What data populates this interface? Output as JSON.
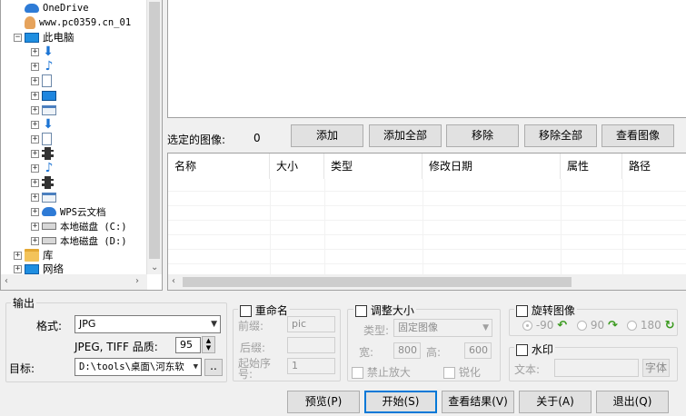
{
  "tree": {
    "items": [
      {
        "label": "OneDrive",
        "icon": "onedrive-cloud-icon"
      },
      {
        "label": "www.pc0359.cn_01",
        "icon": "user-folder-icon"
      },
      {
        "label": "此电脑",
        "icon": "computer-icon"
      },
      {
        "label": "",
        "icon": "downloads-icon"
      },
      {
        "label": "",
        "icon": "music-icon"
      },
      {
        "label": "",
        "icon": "documents-icon"
      },
      {
        "label": "",
        "icon": "desktop-icon"
      },
      {
        "label": "",
        "icon": "window-icon"
      },
      {
        "label": "",
        "icon": "downloads-icon"
      },
      {
        "label": "",
        "icon": "documents-icon"
      },
      {
        "label": "",
        "icon": "video-icon"
      },
      {
        "label": "",
        "icon": "music-icon"
      },
      {
        "label": "",
        "icon": "video-icon"
      },
      {
        "label": "",
        "icon": "window-icon"
      },
      {
        "label": "WPS云文档",
        "icon": "wps-cloud-icon"
      },
      {
        "label": "本地磁盘 (C:)",
        "icon": "drive-icon"
      },
      {
        "label": "本地磁盘 (D:)",
        "icon": "drive-icon"
      },
      {
        "label": "库",
        "icon": "library-folder-icon"
      },
      {
        "label": "网络",
        "icon": "network-icon"
      }
    ]
  },
  "selected": {
    "label": "选定的图像:",
    "count": "0"
  },
  "buttons": {
    "add": "添加",
    "add_all": "添加全部",
    "remove": "移除",
    "remove_all": "移除全部",
    "view_image": "查看图像",
    "preview": "预览(P)",
    "start": "开始(S)",
    "view_result": "查看结果(V)",
    "about": "关于(A)",
    "exit": "退出(Q)",
    "browse": "..",
    "font": "字体"
  },
  "filelist": {
    "columns": [
      "名称",
      "大小",
      "类型",
      "修改日期",
      "属性",
      "路径"
    ]
  },
  "output": {
    "title": "输出",
    "format_label": "格式:",
    "format_value": "JPG",
    "quality_label": "JPEG, TIFF 品质:",
    "quality_value": "95",
    "target_label": "目标:",
    "target_value": "D:\\tools\\桌面\\河东软"
  },
  "rename": {
    "title": "重命名",
    "prefix_label": "前缀:",
    "prefix_value": "pic",
    "suffix_label": "后缀:",
    "suffix_value": "",
    "start_label": "起始序号:",
    "start_value": "1"
  },
  "resize": {
    "title": "调整大小",
    "type_label": "类型:",
    "type_value": "固定图像",
    "width_label": "宽:",
    "width_value": "800",
    "height_label": "高:",
    "height_value": "600",
    "no_enlarge": "禁止放大",
    "sharpen": "锐化"
  },
  "rotate": {
    "title": "旋转图像",
    "options": [
      "-90",
      "90",
      "180"
    ]
  },
  "watermark": {
    "title": "水印",
    "text_label": "文本:",
    "text_value": ""
  },
  "colors": {
    "accent": "#0078d7",
    "rotate_arrow": "#3a9a1e"
  }
}
